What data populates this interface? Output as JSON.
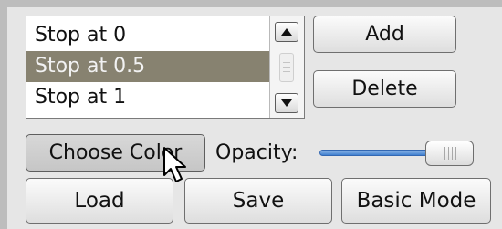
{
  "stop_list": {
    "items": [
      {
        "label": "Stop at 0",
        "selected": false
      },
      {
        "label": "Stop at 0.5",
        "selected": true
      },
      {
        "label": "Stop at 1",
        "selected": false
      }
    ]
  },
  "buttons": {
    "add": "Add",
    "delete": "Delete",
    "choose_color": "Choose Color",
    "load": "Load",
    "save": "Save",
    "basic_mode": "Basic Mode"
  },
  "opacity": {
    "label": "Opacity:",
    "value_fraction": 1.0
  },
  "icons": {
    "scroll_up": "up-arrow-icon",
    "scroll_down": "down-arrow-icon",
    "cursor": "mouse-pointer-icon"
  },
  "colors": {
    "selection": "#878270",
    "slider_fill": "#3f7fd0"
  }
}
